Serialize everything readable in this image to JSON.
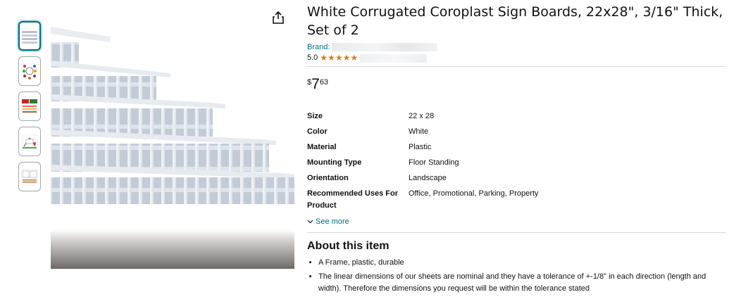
{
  "thumbnails": [
    {
      "label": "thumbnail-1",
      "icon": "corrugated-sheets"
    },
    {
      "label": "thumbnail-2",
      "icon": "uses-collage"
    },
    {
      "label": "thumbnail-3",
      "icon": "benefits-chart"
    },
    {
      "label": "thumbnail-4",
      "icon": "sign-scene"
    },
    {
      "label": "thumbnail-5",
      "icon": "dimensions-diagram"
    }
  ],
  "share_icon": "share-icon",
  "product": {
    "title": "White Corrugated Coroplast Sign Boards, 22x28\", 3/16\" Thick, Set of 2",
    "brand_label": "Brand:",
    "rating_value": "5.0",
    "star_color": "#de7921",
    "price_symbol": "$",
    "price_whole": "7",
    "price_fraction": "63"
  },
  "specs": [
    {
      "key": "Size",
      "value": "22 x 28"
    },
    {
      "key": "Color",
      "value": "White"
    },
    {
      "key": "Material",
      "value": "Plastic"
    },
    {
      "key": "Mounting Type",
      "value": "Floor Standing"
    },
    {
      "key": "Orientation",
      "value": "Landscape"
    },
    {
      "key": "Recommended Uses For Product",
      "value": "Office, Promotional, Parking, Property"
    }
  ],
  "see_more_label": "See more",
  "about": {
    "title": "About this item",
    "bullets": [
      "A Frame, plastic, durable",
      "The linear dimensions of our sheets are nominal and they have a tolerance of +-1/8\" in each direction (length and width). Therefore the dimensions you request will be within the tolerance stated"
    ]
  },
  "colors": {
    "link": "#007185",
    "accent_border": "#007185"
  }
}
